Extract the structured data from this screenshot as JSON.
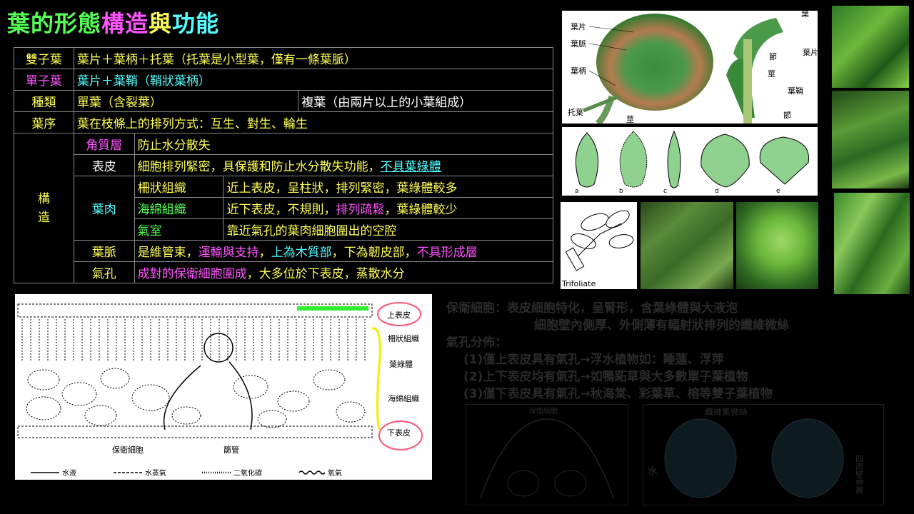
{
  "title": {
    "part1": "葉的形態",
    "part2": "構造",
    "part3": "與",
    "part4": "功能"
  },
  "colors": {
    "yellow": "#ffff55",
    "green": "#55ff55",
    "cyan": "#55ffff",
    "magenta": "#ff55ff",
    "white": "#ffffff"
  },
  "table": {
    "r1": {
      "head": "雙子葉",
      "text": "葉片＋葉柄＋托葉（托葉是小型葉，僅有一條葉脈）"
    },
    "r2": {
      "head": "單子葉",
      "text": "葉片＋葉鞘（鞘狀葉柄）"
    },
    "r3": {
      "head": "種類",
      "simple": "單葉（含裂葉）",
      "compound": "複葉（由兩片以上的小葉組成）"
    },
    "r4": {
      "head": "葉序",
      "text": "葉在枝條上的排列方式：互生、對生、輪生"
    },
    "structure_label": "構\n造",
    "cuticle": {
      "name": "角質層",
      "text": "防止水分散失"
    },
    "epidermis": {
      "name": "表皮",
      "text_a": "細胞排列緊密，具保護和防止水分散失功能，",
      "text_b": "不具葉綠體"
    },
    "mesophyll": "葉肉",
    "palisade": {
      "name": "柵狀組織",
      "text": "近上表皮，呈柱狀，排列緊密，葉綠體較多"
    },
    "spongy": {
      "name": "海綿組織",
      "text_a": "近下表皮，不規則，",
      "text_b": "排列疏鬆",
      "text_c": "，葉綠體較少"
    },
    "air": {
      "name": "氣室",
      "text": "靠近氣孔的葉肉細胞圍出的空腔"
    },
    "vein": {
      "name": "葉脈",
      "text_a": "是維管束，",
      "text_b": "運輸與支持",
      "text_c": "，",
      "text_d": "上為木質部",
      "text_e": "，下為韌皮部，",
      "text_f": "不具形成層"
    },
    "stoma": {
      "name": "氣孔",
      "text_a": "成對的保衛細胞圍成",
      "text_b": "，大多位於下表皮，蒸散水分"
    }
  },
  "leaf_parts": {
    "blade": "葉片",
    "vein": "葉脈",
    "petiole": "葉柄",
    "stipule": "托葉",
    "stem": "莖",
    "leaf": "葉",
    "blade2": "葉片",
    "node": "節",
    "stem2": "莖",
    "sheath": "葉鞘",
    "node2": "節"
  },
  "leaf_shapes": [
    "a",
    "b",
    "c",
    "d",
    "e"
  ],
  "trifoliate": "Trifoliate",
  "cross_section": {
    "upper": "上表皮",
    "palisade": "柵狀組織",
    "chloroplast": "葉綠體",
    "spongy": "海綿組織",
    "lower": "下表皮",
    "guard": "保衛細胞",
    "sieve": "篩管",
    "legend": [
      "水液",
      "水蒸氣",
      "二氧化碳",
      "氧氣"
    ]
  },
  "notes": {
    "l1": "保衛細胞：表皮細胞特化，呈腎形，含葉綠體與大液泡",
    "l2": "細胞壁內側厚、外側薄有輻射狀排列的纖維微絲",
    "l3": "氣孔分佈：",
    "l4": "(1)僅上表皮具有氣孔→浮水植物如：睡蓮、浮萍",
    "l5": "(2)上下表皮均有氣孔→如鴨跖草與大多數單子葉植物",
    "l6": "(3)僅下表皮具有氣孔→秋海棠、彩葉草、榕等雙子葉植物",
    "img_left": "保衛細胞",
    "img_right": "纖維素微絲",
    "img_side": "水",
    "img_vert": "四周壁伸展"
  }
}
